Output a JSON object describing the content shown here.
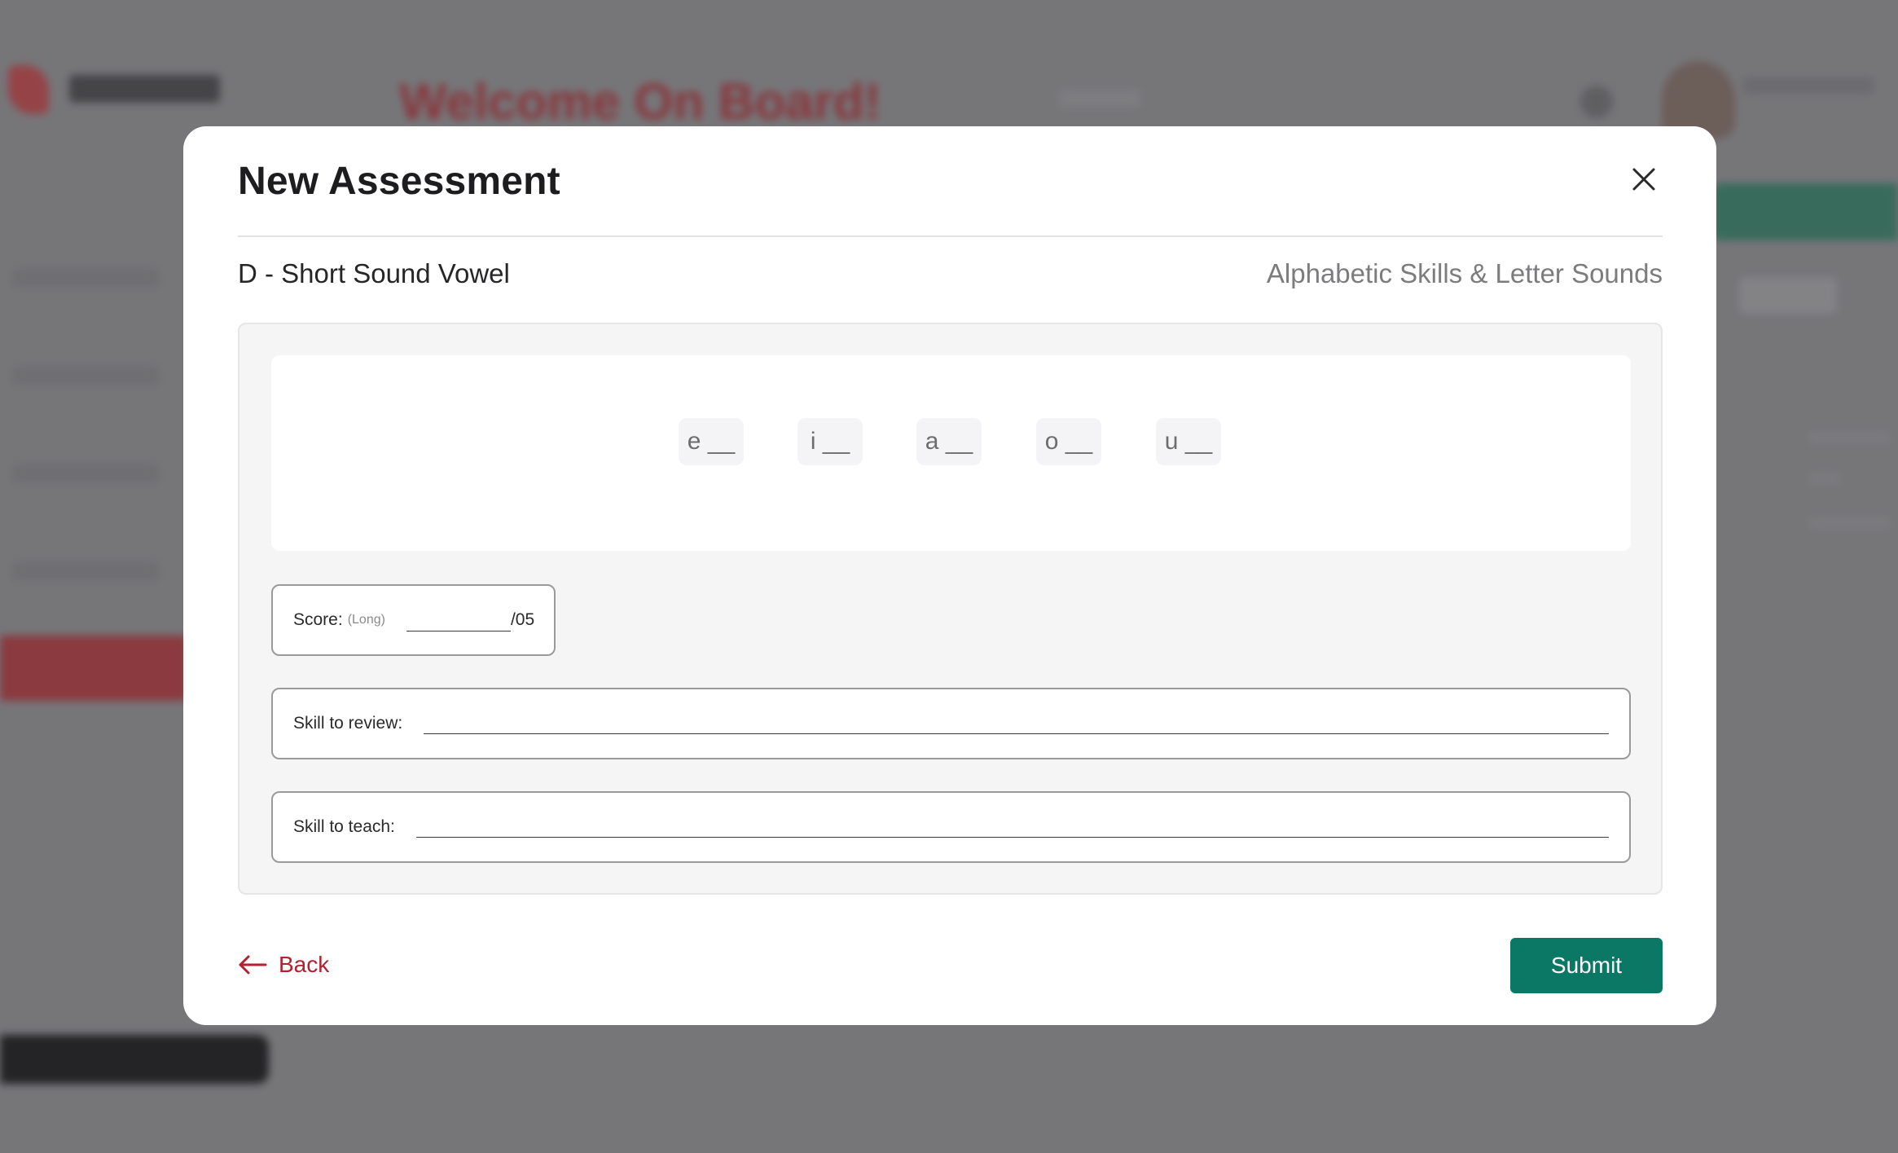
{
  "background": {
    "welcome_text": "Welcome On Board!"
  },
  "modal": {
    "title": "New Assessment",
    "close_icon": "close-icon",
    "subtitle": "D - Short Sound Vowel",
    "category": "Alphabetic Skills & Letter Sounds",
    "letters": [
      "e __",
      "i __",
      "a __",
      "o __",
      "u __"
    ],
    "score": {
      "label": "Score:",
      "hint": "(Long)",
      "value": "",
      "max": "/05"
    },
    "skill_review": {
      "label": "Skill to review:",
      "value": ""
    },
    "skill_teach": {
      "label": "Skill to teach:",
      "value": ""
    },
    "back_label": "Back",
    "back_icon": "arrow-left-icon",
    "submit_label": "Submit",
    "colors": {
      "accent_green": "#0b7866",
      "back_red": "#b3202f"
    }
  }
}
